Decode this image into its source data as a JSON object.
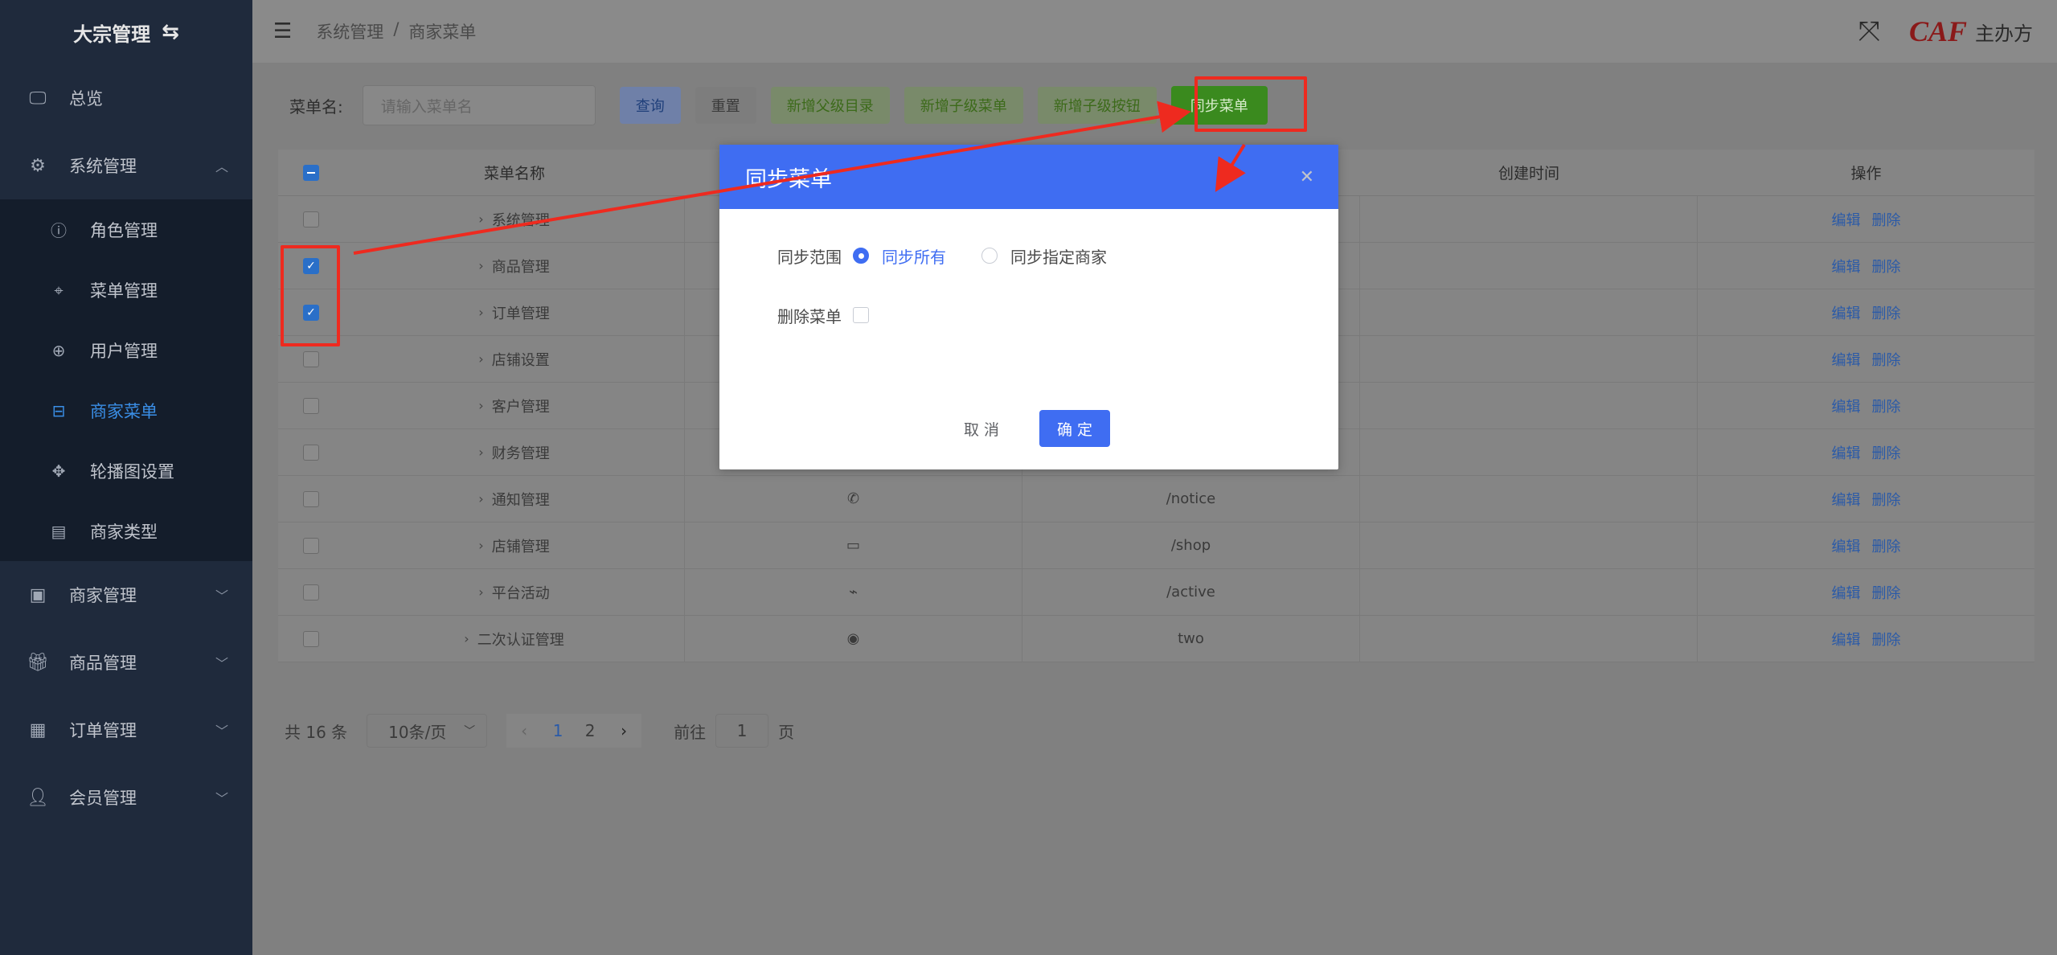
{
  "sidebar": {
    "brand": "大宗管理",
    "items": [
      {
        "label": "总览",
        "icon": "monitor-icon"
      },
      {
        "label": "系统管理",
        "icon": "gear-icon",
        "expanded": true
      },
      {
        "label": "商家管理",
        "icon": "shop-icon"
      },
      {
        "label": "商品管理",
        "icon": "gift-icon"
      },
      {
        "label": "订单管理",
        "icon": "document-icon"
      },
      {
        "label": "会员管理",
        "icon": "user-icon"
      }
    ],
    "sub_items": [
      {
        "label": "角色管理",
        "icon": "info-circle-icon"
      },
      {
        "label": "菜单管理",
        "icon": "location-icon"
      },
      {
        "label": "用户管理",
        "icon": "zoom-icon"
      },
      {
        "label": "商家菜单",
        "icon": "box-icon",
        "active": true
      },
      {
        "label": "轮播图设置",
        "icon": "move-icon"
      },
      {
        "label": "商家类型",
        "icon": "notebook-icon"
      }
    ]
  },
  "header": {
    "breadcrumb": [
      "系统管理",
      "商家菜单"
    ],
    "logo": "CAF",
    "host": "主办方"
  },
  "toolbar": {
    "label": "菜单名:",
    "search_placeholder": "请输入菜单名",
    "query": "查询",
    "reset": "重置",
    "add_parent": "新增父级目录",
    "add_child_menu": "新增子级菜单",
    "add_child_button": "新增子级按钮",
    "sync": "同步菜单"
  },
  "table": {
    "headers": {
      "name": "菜单名称",
      "created": "创建时间",
      "op": "操作"
    },
    "rows": [
      {
        "name": "系统管理",
        "icon": "",
        "path": "",
        "checked": false
      },
      {
        "name": "商品管理",
        "icon": "",
        "path": "",
        "checked": true
      },
      {
        "name": "订单管理",
        "icon": "",
        "path": "",
        "checked": true
      },
      {
        "name": "店铺设置",
        "icon": "",
        "path": "",
        "checked": false
      },
      {
        "name": "客户管理",
        "icon": "",
        "path": "",
        "checked": false
      },
      {
        "name": "财务管理",
        "icon": "",
        "path": "",
        "checked": false
      },
      {
        "name": "通知管理",
        "icon": "✆",
        "path": "/notice",
        "checked": false
      },
      {
        "name": "店铺管理",
        "icon": "▭",
        "path": "/shop",
        "checked": false
      },
      {
        "name": "平台活动",
        "icon": "⌁",
        "path": "/active",
        "checked": false
      },
      {
        "name": "二次认证管理",
        "icon": "◉",
        "path": "two",
        "checked": false
      }
    ],
    "edit": "编辑",
    "delete": "删除"
  },
  "pagination": {
    "total": "共 16 条",
    "page_size": "10条/页",
    "pages": [
      "1",
      "2"
    ],
    "current": "1",
    "goto_prefix": "前往",
    "goto_value": "1",
    "goto_suffix": "页"
  },
  "dialog": {
    "title": "同步菜单",
    "range_label": "同步范围",
    "option_all": "同步所有",
    "option_specific": "同步指定商家",
    "delete_label": "删除菜单",
    "cancel": "取 消",
    "confirm": "确 定"
  },
  "colors": {
    "annotation": "#ee2a1f",
    "primary": "#3f6df2",
    "sync_button": "#3a8a1e"
  }
}
